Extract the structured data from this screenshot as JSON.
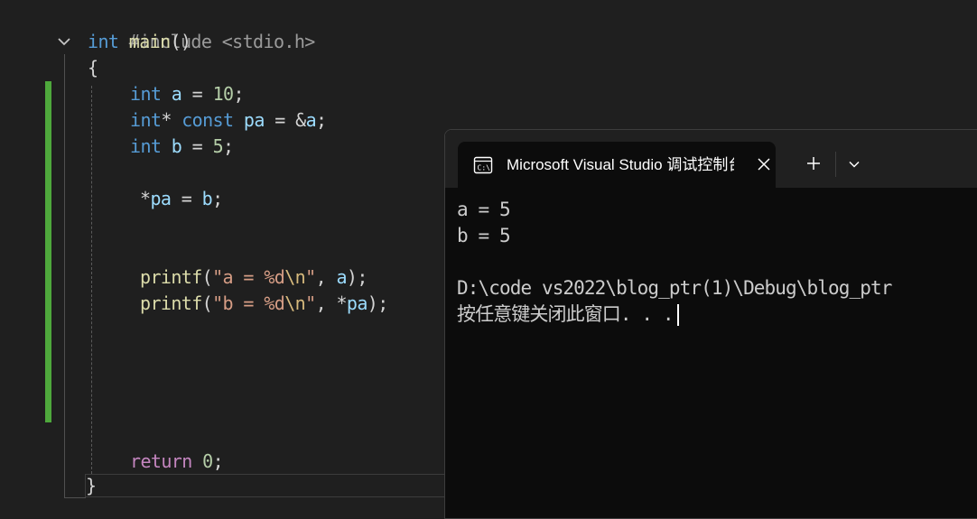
{
  "editor": {
    "lines": {
      "l1": {
        "pp": "#include <stdio.h>"
      },
      "l2": {
        "kw": "int",
        "fn": "main",
        "rest": "()"
      },
      "l3": {
        "brace": "{"
      },
      "l4": {
        "kw": "int",
        "var": "a",
        "op": " = ",
        "num": "10",
        "end": ";"
      },
      "l5": {
        "kw": "int",
        "star": "*",
        "kw2": "const",
        "var": "pa",
        "op": " = &",
        "var2": "a",
        "end": ";"
      },
      "l6": {
        "kw": "int",
        "var": "b",
        "op": " = ",
        "num": "5",
        "end": ";"
      },
      "l7": {
        "star": "*",
        "var": "pa",
        "op": " = ",
        "var2": "b",
        "end": ";"
      },
      "l8": {
        "fn": "printf",
        "open": "(",
        "q1": "\"a = ",
        "fmt": "%d",
        "esc": "\\n",
        "q2": "\"",
        "comma": ", ",
        "var": "a",
        "end": ");"
      },
      "l9": {
        "fn": "printf",
        "open": "(",
        "q1": "\"b = ",
        "fmt": "%d",
        "esc": "\\n",
        "q2": "\"",
        "comma": ", *",
        "var": "pa",
        "end": ");"
      },
      "l10": {
        "kw": "return",
        "num": "0",
        "end": ";"
      },
      "l11": {
        "brace": "}"
      }
    }
  },
  "terminal": {
    "tab_title": "Microsoft Visual Studio 调试控制台",
    "tab_icon": "console-icon",
    "output": [
      "a = 5",
      "b = 5",
      "",
      "D:\\code vs2022\\blog_ptr(1)\\Debug\\blog_ptr",
      "按任意键关闭此窗口. . ."
    ]
  },
  "colors": {
    "editor_bg": "#1f1f1f",
    "keyword": "#569cd6",
    "function": "#dcdcaa",
    "variable": "#9cdcfe",
    "number": "#b5cea8",
    "string": "#d69d85",
    "modified_bar": "#4ea83c",
    "terminal_bg": "#0c0c0c"
  }
}
